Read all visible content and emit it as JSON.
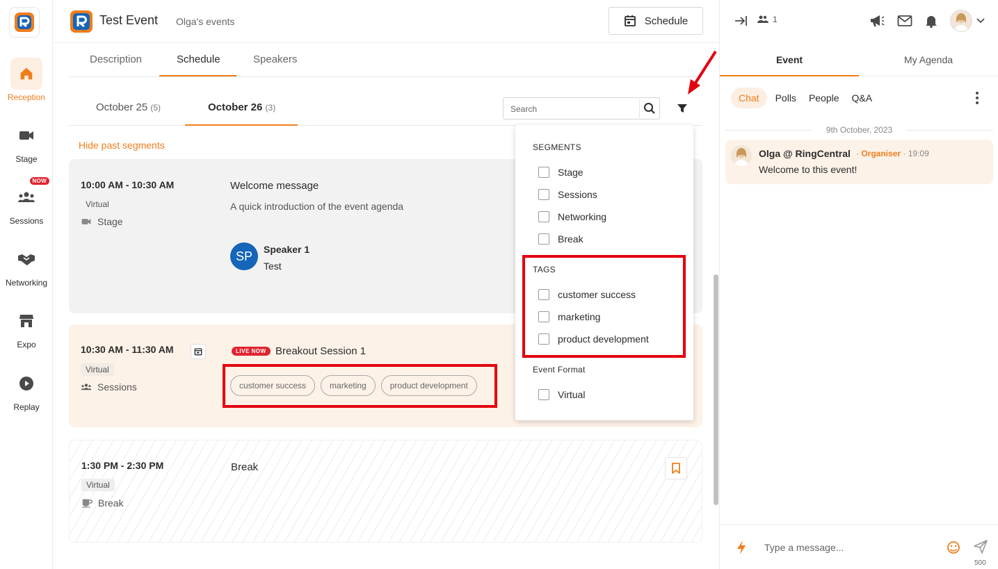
{
  "colors": {
    "accent": "#f07d1a",
    "live": "#e02430",
    "highlight": "#e3000f",
    "speaker_avatar": "#1565b8"
  },
  "nav": {
    "items": [
      {
        "label": "Reception",
        "icon": "home-icon",
        "active": true
      },
      {
        "label": "Stage",
        "icon": "video-camera-icon"
      },
      {
        "label": "Sessions",
        "icon": "people-group-icon",
        "badge": "NOW"
      },
      {
        "label": "Networking",
        "icon": "handshake-icon"
      },
      {
        "label": "Expo",
        "icon": "store-icon"
      },
      {
        "label": "Replay",
        "icon": "play-circle-icon"
      }
    ]
  },
  "header": {
    "title": "Test Event",
    "subtitle": "Olga's events",
    "schedule_label": "Schedule"
  },
  "tabs": [
    {
      "label": "Description"
    },
    {
      "label": "Schedule"
    },
    {
      "label": "Speakers"
    }
  ],
  "dates": [
    {
      "label": "October 25",
      "count": "(5)"
    },
    {
      "label": "October 26",
      "count": "(3)"
    }
  ],
  "search": {
    "placeholder": "Search"
  },
  "hide_past_label": "Hide past segments",
  "segments": [
    {
      "time": "10:00 AM - 10:30 AM",
      "format": "Virtual",
      "type": "Stage",
      "title": "Welcome message",
      "description": "A quick introduction of the event agenda",
      "speaker": {
        "initials": "SP",
        "name": "Speaker 1",
        "role": "Test"
      }
    },
    {
      "time": "10:30 AM - 11:30 AM",
      "format": "Virtual",
      "type": "Sessions",
      "live_label": "LIVE NOW",
      "title": "Breakout Session 1",
      "tags": [
        "customer success",
        "marketing",
        "product development"
      ]
    },
    {
      "time": "1:30 PM - 2:30 PM",
      "format": "Virtual",
      "type": "Break",
      "title": "Break"
    }
  ],
  "filter": {
    "segments_heading": "SEGMENTS",
    "segments": [
      "Stage",
      "Sessions",
      "Networking",
      "Break"
    ],
    "tags_heading": "TAGS",
    "tags": [
      "customer success",
      "marketing",
      "product development"
    ],
    "format_heading": "Event Format",
    "formats": [
      "Virtual"
    ]
  },
  "right": {
    "attendee_count": "1",
    "tabs": [
      "Event",
      "My Agenda"
    ],
    "subtabs": [
      "Chat",
      "Polls",
      "People",
      "Q&A"
    ],
    "date_separator": "9th October, 2023",
    "message": {
      "name": "Olga @ RingCentral",
      "role": "Organiser",
      "time": "19:09",
      "text": "Welcome to this event!"
    },
    "composer": {
      "placeholder": "Type a message...",
      "char_count": "500"
    }
  }
}
